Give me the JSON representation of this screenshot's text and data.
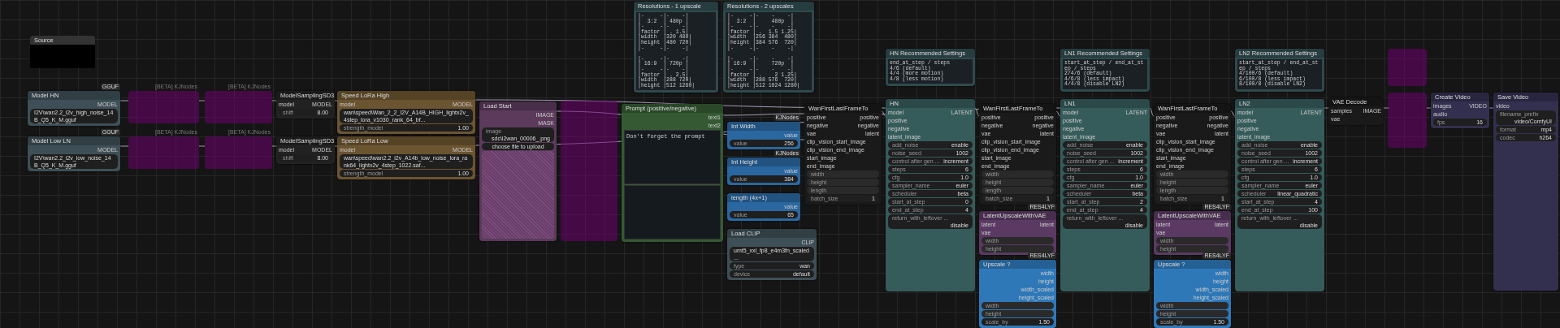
{
  "nodes": [
    {
      "kind": "note",
      "title": "Resolutions - 1 upscale",
      "text": "|-     -|-    -|\n|  3:2  | 480p |\n|-     -|-    -|\n|factor | . 1.5|\n|width  |320 480|\n|height |480 720|\n|-     -|-    -|\n\n|-     -|-    -|\n| 16:9  | 720p |\n|-     -|-    -|\n|factor | . 2.5|\n|width  |288 720|\n|height |512 1280|"
    },
    {
      "kind": "note",
      "title": "Resolutions - 2 upscales",
      "text": "|-     -|-    -    -|\n|  3:2  |     480p  |\n|-     -|-    -    -|\n|factor | .  1.5 1.25|\n|width  |256 384  480|\n|height |384 576  720|\n|-     -|-    -    -|\n\n|-     -|-    -    -|\n| 16:9  |     720p  |\n|-     -|-    -    -|\n|factor | .    2 1.25|\n|width  |288 576  720|\n|height |512 1024 1280|"
    },
    {
      "kind": "group",
      "title": "Source"
    },
    {
      "kind": "node",
      "title": "Model HN",
      "color": "#3e4f57",
      "badge": "GGUF",
      "outputs": [
        "MODEL"
      ],
      "widgets": [
        {
          "kind": "combo",
          "value": "I2V\\wan2.2_i2v_high_noise_14B_Q5_K_M.gguf"
        }
      ]
    },
    {
      "kind": "bypass",
      "badge": "[BETA] KJNodes"
    },
    {
      "kind": "bypass",
      "badge": "[BETA] KJNodes"
    },
    {
      "kind": "node",
      "title": "ModelSamplingSD3",
      "color": "#222222",
      "inputs": [
        "model"
      ],
      "outputs": [
        "MODEL"
      ],
      "widgets": [
        {
          "kind": "number",
          "label": "shift",
          "value": "8.00"
        }
      ]
    },
    {
      "kind": "node",
      "title": "Speed LoRa High",
      "color": "#6b5430",
      "inputs": [
        "model"
      ],
      "outputs": [
        "MODEL"
      ],
      "widgets": [
        {
          "kind": "combo",
          "value": "wan\\speed\\Wan_2_2_I2V_A14B_HIGH_lightx2v_4step_lora_v1030_rank_64_bf..."
        },
        {
          "kind": "number",
          "label": "strength_model",
          "value": "1.00"
        }
      ]
    },
    {
      "kind": "node",
      "title": "Model Low LN",
      "color": "#3e4f57",
      "badge": "GGUF",
      "outputs": [
        "MODEL"
      ],
      "widgets": [
        {
          "kind": "combo",
          "value": "I2V\\wan2.2_i2v_low_noise_14B_Q5_K_M.gguf"
        }
      ]
    },
    {
      "kind": "bypass",
      "badge": "[BETA] KJNodes"
    },
    {
      "kind": "bypass",
      "badge": "[BETA] KJNodes"
    },
    {
      "kind": "node",
      "title": "ModelSamplingSD3",
      "color": "#222222",
      "inputs": [
        "model"
      ],
      "outputs": [
        "MODEL"
      ],
      "widgets": [
        {
          "kind": "number",
          "label": "shift",
          "value": "8.00"
        }
      ]
    },
    {
      "kind": "node",
      "title": "Speed LoRa Low",
      "color": "#6b5430",
      "inputs": [
        "model"
      ],
      "outputs": [
        "MODEL"
      ],
      "widgets": [
        {
          "kind": "combo",
          "value": "wan\\speed\\wan2.2_i2v_A14b_low_noise_lora_rank64_lightx2v_4step_1022.saf..."
        },
        {
          "kind": "number",
          "label": "strength_model",
          "value": "1.00"
        }
      ]
    },
    {
      "kind": "node",
      "title": "Load Start",
      "color": "#5b3a5b",
      "outputs": [
        "IMAGE",
        "MASK"
      ],
      "widgets": [
        {
          "kind": "combo",
          "label": "image",
          "value": "sdc\\l2wan_00006_.png"
        },
        {
          "kind": "button",
          "label": "choose file to upload"
        },
        {
          "kind": "image"
        }
      ]
    },
    {
      "kind": "bypass"
    },
    {
      "kind": "node",
      "title": "Prompt (positive/negative)",
      "color": "#355a33",
      "outputs": [
        "text1",
        "text2"
      ],
      "widgets": [
        {
          "kind": "textarea",
          "value": "Don't forget the prompt"
        },
        {
          "kind": "textarea"
        }
      ]
    },
    {
      "kind": "node",
      "title": "Int Width",
      "color": "#2a67a0",
      "badge": "KJNodes",
      "outputs": [
        "value"
      ],
      "widgets": [
        {
          "kind": "number",
          "label": "value",
          "value": "256"
        }
      ]
    },
    {
      "kind": "node",
      "title": "Int Height",
      "color": "#2a67a0",
      "badge": "KJNodes",
      "outputs": [
        "value"
      ],
      "widgets": [
        {
          "kind": "number",
          "label": "value",
          "value": "384"
        }
      ]
    },
    {
      "kind": "node",
      "title": "length (4x+1)",
      "color": "#2a67a0",
      "outputs": [
        "value"
      ],
      "widgets": [
        {
          "kind": "number",
          "label": "value",
          "value": "65"
        }
      ]
    },
    {
      "kind": "node",
      "title": "Load CLIP",
      "color": "#3e4f57",
      "outputs": [
        "CLIP"
      ],
      "widgets": [
        {
          "kind": "combo",
          "value": "umt5_xxl_fp8_e4m3fn_scaled ..."
        },
        {
          "kind": "combo",
          "label": "type",
          "value": "wan"
        },
        {
          "kind": "combo",
          "label": "device",
          "value": "default"
        }
      ]
    },
    {
      "kind": "node",
      "title": "WanFirstLastFrameTo",
      "color": "#1a1a1a",
      "inputs": [
        "positive",
        "negative",
        "vae",
        "clip_vision_start_image",
        "clip_vision_end_image",
        "start_image",
        "end_image"
      ],
      "outputs": [
        "positive",
        "negative",
        "latent"
      ],
      "widgets": [
        {
          "kind": "input",
          "label": "width"
        },
        {
          "kind": "input",
          "label": "height"
        },
        {
          "kind": "input",
          "label": "length"
        },
        {
          "kind": "number",
          "label": "batch_size",
          "value": "1"
        }
      ]
    },
    {
      "kind": "note",
      "title": "HN Recommended Settings",
      "text": "end_at_step / steps\n4/6 (default)\n4/4 (more motion)\n4/8 (less motion)"
    },
    {
      "kind": "node",
      "title": "HN",
      "color": "#355c5a",
      "inputs": [
        "model",
        "positive",
        "negative",
        "latent_image"
      ],
      "outputs": [
        "LATENT"
      ],
      "widgets": [
        {
          "kind": "combo",
          "label": "add_noise",
          "value": "enable"
        },
        {
          "kind": "number",
          "label": "noise_seed",
          "value": "1002"
        },
        {
          "kind": "combo",
          "label": "control after gen ...",
          "value": "increment"
        },
        {
          "kind": "number",
          "label": "steps",
          "value": "6"
        },
        {
          "kind": "number",
          "label": "cfg",
          "value": "1.0"
        },
        {
          "kind": "combo",
          "label": "sampler_name",
          "value": "euler"
        },
        {
          "kind": "combo",
          "label": "scheduler",
          "value": "beta"
        },
        {
          "kind": "number",
          "label": "start_at_step",
          "value": "0"
        },
        {
          "kind": "number",
          "label": "end_at_step",
          "value": "4"
        },
        {
          "kind": "combo",
          "label": "return_with_leftover ...",
          "value": "disable"
        }
      ]
    },
    {
      "kind": "node",
      "title": "WanFirstLastFrameTo",
      "color": "#1a1a1a",
      "inputs": [
        "positive",
        "negative",
        "vae",
        "clip_vision_start_image",
        "clip_vision_end_image",
        "start_image",
        "end_image"
      ],
      "outputs": [
        "positive",
        "negative",
        "latent"
      ],
      "widgets": [
        {
          "kind": "input",
          "label": "width"
        },
        {
          "kind": "input",
          "label": "height"
        },
        {
          "kind": "input",
          "label": "length"
        },
        {
          "kind": "number",
          "label": "batch_size",
          "value": "1"
        }
      ]
    },
    {
      "kind": "node",
      "title": "LatentUpscaleWithVAE",
      "color": "#5a3a62",
      "badge": "RES4LYF",
      "inputs": [
        "latent",
        "vae"
      ],
      "outputs": [
        "latent"
      ],
      "widgets": [
        {
          "kind": "input",
          "label": "width"
        },
        {
          "kind": "input",
          "label": "height"
        }
      ]
    },
    {
      "kind": "node",
      "title": "Upscale ?",
      "color": "#2e78b8",
      "badge": "RES4LYF",
      "outputs": [
        "width",
        "height",
        "width_scaled",
        "height_scaled"
      ],
      "widgets": [
        {
          "kind": "input",
          "label": "width"
        },
        {
          "kind": "input",
          "label": "height"
        },
        {
          "kind": "number",
          "label": "scale_by",
          "value": "1.50"
        }
      ]
    },
    {
      "kind": "note",
      "title": "LN1 Recommended Settings",
      "text": "start_at_step / end_at_step / steps\n2/4/6 (default)\n4/6/8 (less impact)\n4/4/8 (disable LN2)"
    },
    {
      "kind": "node",
      "title": "LN1",
      "color": "#355c5a",
      "inputs": [
        "model",
        "positive",
        "negative",
        "latent_image"
      ],
      "outputs": [
        "LATENT"
      ],
      "widgets": [
        {
          "kind": "combo",
          "label": "add_noise",
          "value": "enable"
        },
        {
          "kind": "number",
          "label": "noise_seed",
          "value": "1002"
        },
        {
          "kind": "combo",
          "label": "control after gen ...",
          "value": "increment"
        },
        {
          "kind": "number",
          "label": "steps",
          "value": "6"
        },
        {
          "kind": "number",
          "label": "cfg",
          "value": "1.0"
        },
        {
          "kind": "combo",
          "label": "sampler_name",
          "value": "euler"
        },
        {
          "kind": "combo",
          "label": "scheduler",
          "value": "beta"
        },
        {
          "kind": "number",
          "label": "start_at_step",
          "value": "2"
        },
        {
          "kind": "number",
          "label": "end_at_step",
          "value": "4"
        },
        {
          "kind": "combo",
          "label": "return_with_leftover ...",
          "value": "disable"
        }
      ]
    },
    {
      "kind": "node",
      "title": "WanFirstLastFrameTo",
      "color": "#1a1a1a",
      "inputs": [
        "positive",
        "negative",
        "vae",
        "clip_vision_start_image",
        "clip_vision_end_image",
        "start_image",
        "end_image"
      ],
      "outputs": [
        "positive",
        "negative",
        "latent"
      ],
      "widgets": [
        {
          "kind": "input",
          "label": "width"
        },
        {
          "kind": "input",
          "label": "height"
        },
        {
          "kind": "input",
          "label": "length"
        },
        {
          "kind": "number",
          "label": "batch_size",
          "value": "1"
        }
      ]
    },
    {
      "kind": "node",
      "title": "LatentUpscaleWithVAE",
      "color": "#5a3a62",
      "badge": "RES4LYF",
      "inputs": [
        "latent",
        "vae"
      ],
      "outputs": [
        "latent"
      ],
      "widgets": [
        {
          "kind": "input",
          "label": "width"
        },
        {
          "kind": "input",
          "label": "height"
        }
      ]
    },
    {
      "kind": "node",
      "title": "Upscale ?",
      "color": "#2e78b8",
      "badge": "RES4LYF",
      "outputs": [
        "width",
        "height",
        "width_scaled",
        "height_scaled"
      ],
      "widgets": [
        {
          "kind": "input",
          "label": "width"
        },
        {
          "kind": "input",
          "label": "height"
        },
        {
          "kind": "number",
          "label": "scale_by",
          "value": "1.50"
        }
      ]
    },
    {
      "kind": "note",
      "title": "LN2 Recommended Settings",
      "text": "start_at_step / end_at_step / steps\n4/100/6 (default)\n6/100/8 (less impact)\n8/100/8 (disable LN2)"
    },
    {
      "kind": "node",
      "title": "LN2",
      "color": "#355c5a",
      "inputs": [
        "model",
        "positive",
        "negative",
        "latent_image"
      ],
      "outputs": [
        "LATENT"
      ],
      "widgets": [
        {
          "kind": "combo",
          "label": "add_noise",
          "value": "enable"
        },
        {
          "kind": "number",
          "label": "noise_seed",
          "value": "1002"
        },
        {
          "kind": "combo",
          "label": "control after gen ...",
          "value": "increment"
        },
        {
          "kind": "number",
          "label": "steps",
          "value": "6"
        },
        {
          "kind": "number",
          "label": "cfg",
          "value": "1.0"
        },
        {
          "kind": "combo",
          "label": "sampler_name",
          "value": "euler"
        },
        {
          "kind": "combo",
          "label": "scheduler",
          "value": "linear_quadratic"
        },
        {
          "kind": "number",
          "label": "start_at_step",
          "value": "4"
        },
        {
          "kind": "number",
          "label": "end_at_step",
          "value": "100"
        },
        {
          "kind": "combo",
          "label": "return_with_leftover ...",
          "value": "disable"
        }
      ]
    },
    {
      "kind": "node",
      "title": "VAE Decode",
      "color": "#1a1a1a",
      "inputs": [
        "samples",
        "vae"
      ],
      "outputs": [
        "IMAGE"
      ]
    },
    {
      "kind": "bypass"
    },
    {
      "kind": "bypass"
    },
    {
      "kind": "node",
      "title": "Create Video",
      "color": "#33304f",
      "inputs": [
        "images",
        "audio"
      ],
      "outputs": [
        "VIDEO"
      ],
      "widgets": [
        {
          "kind": "number",
          "label": "fps",
          "value": "16"
        }
      ]
    },
    {
      "kind": "node",
      "title": "Save Video",
      "color": "#33304f",
      "inputs": [
        "video"
      ],
      "widgets": [
        {
          "kind": "text",
          "label": "filename_prefix",
          "value": "video/ComfyUI"
        },
        {
          "kind": "combo",
          "label": "format",
          "value": "mp4"
        },
        {
          "kind": "combo",
          "label": "codec",
          "value": "h264"
        }
      ]
    }
  ]
}
